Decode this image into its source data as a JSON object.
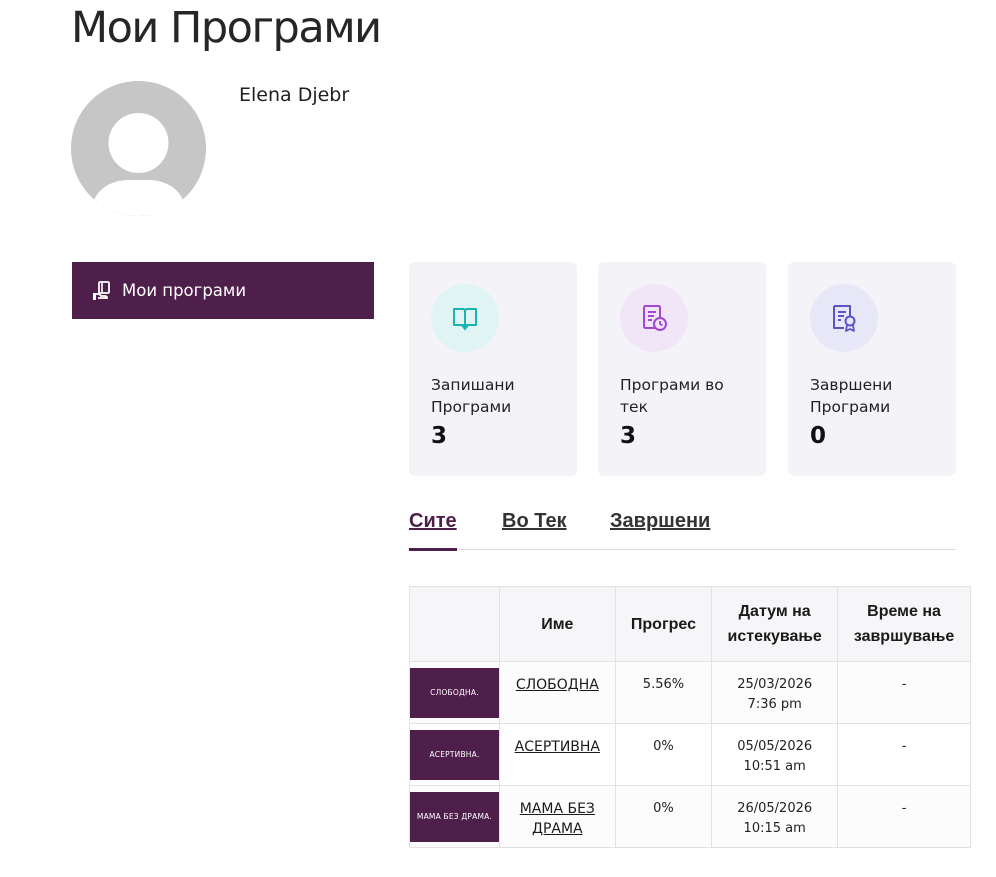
{
  "page": {
    "title": "Мои Програми"
  },
  "user": {
    "name": "Elena Djebr"
  },
  "sidebar": {
    "items": [
      {
        "label": "Мои програми",
        "icon": "hand-book-icon"
      }
    ]
  },
  "stats": [
    {
      "label": "Запишани Програми",
      "value": "3",
      "icon": "open-book-icon",
      "bg": "#dff4f3",
      "color": "#1bb5b0"
    },
    {
      "label": "Програми во тек",
      "value": "3",
      "icon": "document-clock-icon",
      "bg": "#f1e6f8",
      "color": "#a246d6"
    },
    {
      "label": "Завршени Програми",
      "value": "0",
      "icon": "certificate-icon",
      "bg": "#e7e7f7",
      "color": "#5b54c7"
    }
  ],
  "tabs": [
    {
      "label": "Сите",
      "active": true
    },
    {
      "label": "Во Тек",
      "active": false
    },
    {
      "label": "Завршени",
      "active": false
    }
  ],
  "table": {
    "headers": [
      "",
      "Име",
      "Прогрес",
      "Датум на истекување",
      "Време на завршување"
    ],
    "rows": [
      {
        "thumb": "СЛОБОДНА.",
        "name": "СЛОБОДНА",
        "progress": "5.56%",
        "expiry": "25/03/2026 7:36 pm",
        "completed": "-"
      },
      {
        "thumb": "АСЕРТИВНА.",
        "name": "АСЕРТИВНА",
        "progress": "0%",
        "expiry": "05/05/2026 10:51 am",
        "completed": "-"
      },
      {
        "thumb": "МАМА БЕЗ ДРАМА.",
        "name": "МАМА БЕЗ ДРАМА",
        "progress": "0%",
        "expiry": "26/05/2026 10:15 am",
        "completed": "-"
      }
    ]
  },
  "colors": {
    "brand": "#4e1f4b"
  }
}
